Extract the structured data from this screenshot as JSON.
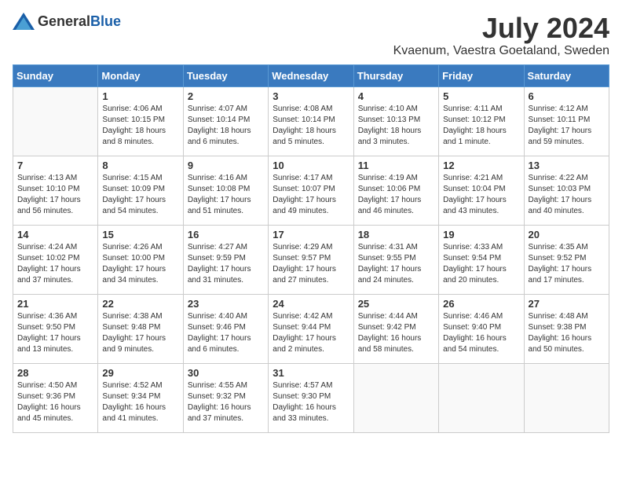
{
  "header": {
    "logo_general": "General",
    "logo_blue": "Blue",
    "month_title": "July 2024",
    "location": "Kvaenum, Vaestra Goetaland, Sweden"
  },
  "days_of_week": [
    "Sunday",
    "Monday",
    "Tuesday",
    "Wednesday",
    "Thursday",
    "Friday",
    "Saturday"
  ],
  "weeks": [
    [
      {
        "day": "",
        "info": ""
      },
      {
        "day": "1",
        "info": "Sunrise: 4:06 AM\nSunset: 10:15 PM\nDaylight: 18 hours\nand 8 minutes."
      },
      {
        "day": "2",
        "info": "Sunrise: 4:07 AM\nSunset: 10:14 PM\nDaylight: 18 hours\nand 6 minutes."
      },
      {
        "day": "3",
        "info": "Sunrise: 4:08 AM\nSunset: 10:14 PM\nDaylight: 18 hours\nand 5 minutes."
      },
      {
        "day": "4",
        "info": "Sunrise: 4:10 AM\nSunset: 10:13 PM\nDaylight: 18 hours\nand 3 minutes."
      },
      {
        "day": "5",
        "info": "Sunrise: 4:11 AM\nSunset: 10:12 PM\nDaylight: 18 hours\nand 1 minute."
      },
      {
        "day": "6",
        "info": "Sunrise: 4:12 AM\nSunset: 10:11 PM\nDaylight: 17 hours\nand 59 minutes."
      }
    ],
    [
      {
        "day": "7",
        "info": "Sunrise: 4:13 AM\nSunset: 10:10 PM\nDaylight: 17 hours\nand 56 minutes."
      },
      {
        "day": "8",
        "info": "Sunrise: 4:15 AM\nSunset: 10:09 PM\nDaylight: 17 hours\nand 54 minutes."
      },
      {
        "day": "9",
        "info": "Sunrise: 4:16 AM\nSunset: 10:08 PM\nDaylight: 17 hours\nand 51 minutes."
      },
      {
        "day": "10",
        "info": "Sunrise: 4:17 AM\nSunset: 10:07 PM\nDaylight: 17 hours\nand 49 minutes."
      },
      {
        "day": "11",
        "info": "Sunrise: 4:19 AM\nSunset: 10:06 PM\nDaylight: 17 hours\nand 46 minutes."
      },
      {
        "day": "12",
        "info": "Sunrise: 4:21 AM\nSunset: 10:04 PM\nDaylight: 17 hours\nand 43 minutes."
      },
      {
        "day": "13",
        "info": "Sunrise: 4:22 AM\nSunset: 10:03 PM\nDaylight: 17 hours\nand 40 minutes."
      }
    ],
    [
      {
        "day": "14",
        "info": "Sunrise: 4:24 AM\nSunset: 10:02 PM\nDaylight: 17 hours\nand 37 minutes."
      },
      {
        "day": "15",
        "info": "Sunrise: 4:26 AM\nSunset: 10:00 PM\nDaylight: 17 hours\nand 34 minutes."
      },
      {
        "day": "16",
        "info": "Sunrise: 4:27 AM\nSunset: 9:59 PM\nDaylight: 17 hours\nand 31 minutes."
      },
      {
        "day": "17",
        "info": "Sunrise: 4:29 AM\nSunset: 9:57 PM\nDaylight: 17 hours\nand 27 minutes."
      },
      {
        "day": "18",
        "info": "Sunrise: 4:31 AM\nSunset: 9:55 PM\nDaylight: 17 hours\nand 24 minutes."
      },
      {
        "day": "19",
        "info": "Sunrise: 4:33 AM\nSunset: 9:54 PM\nDaylight: 17 hours\nand 20 minutes."
      },
      {
        "day": "20",
        "info": "Sunrise: 4:35 AM\nSunset: 9:52 PM\nDaylight: 17 hours\nand 17 minutes."
      }
    ],
    [
      {
        "day": "21",
        "info": "Sunrise: 4:36 AM\nSunset: 9:50 PM\nDaylight: 17 hours\nand 13 minutes."
      },
      {
        "day": "22",
        "info": "Sunrise: 4:38 AM\nSunset: 9:48 PM\nDaylight: 17 hours\nand 9 minutes."
      },
      {
        "day": "23",
        "info": "Sunrise: 4:40 AM\nSunset: 9:46 PM\nDaylight: 17 hours\nand 6 minutes."
      },
      {
        "day": "24",
        "info": "Sunrise: 4:42 AM\nSunset: 9:44 PM\nDaylight: 17 hours\nand 2 minutes."
      },
      {
        "day": "25",
        "info": "Sunrise: 4:44 AM\nSunset: 9:42 PM\nDaylight: 16 hours\nand 58 minutes."
      },
      {
        "day": "26",
        "info": "Sunrise: 4:46 AM\nSunset: 9:40 PM\nDaylight: 16 hours\nand 54 minutes."
      },
      {
        "day": "27",
        "info": "Sunrise: 4:48 AM\nSunset: 9:38 PM\nDaylight: 16 hours\nand 50 minutes."
      }
    ],
    [
      {
        "day": "28",
        "info": "Sunrise: 4:50 AM\nSunset: 9:36 PM\nDaylight: 16 hours\nand 45 minutes."
      },
      {
        "day": "29",
        "info": "Sunrise: 4:52 AM\nSunset: 9:34 PM\nDaylight: 16 hours\nand 41 minutes."
      },
      {
        "day": "30",
        "info": "Sunrise: 4:55 AM\nSunset: 9:32 PM\nDaylight: 16 hours\nand 37 minutes."
      },
      {
        "day": "31",
        "info": "Sunrise: 4:57 AM\nSunset: 9:30 PM\nDaylight: 16 hours\nand 33 minutes."
      },
      {
        "day": "",
        "info": ""
      },
      {
        "day": "",
        "info": ""
      },
      {
        "day": "",
        "info": ""
      }
    ]
  ]
}
